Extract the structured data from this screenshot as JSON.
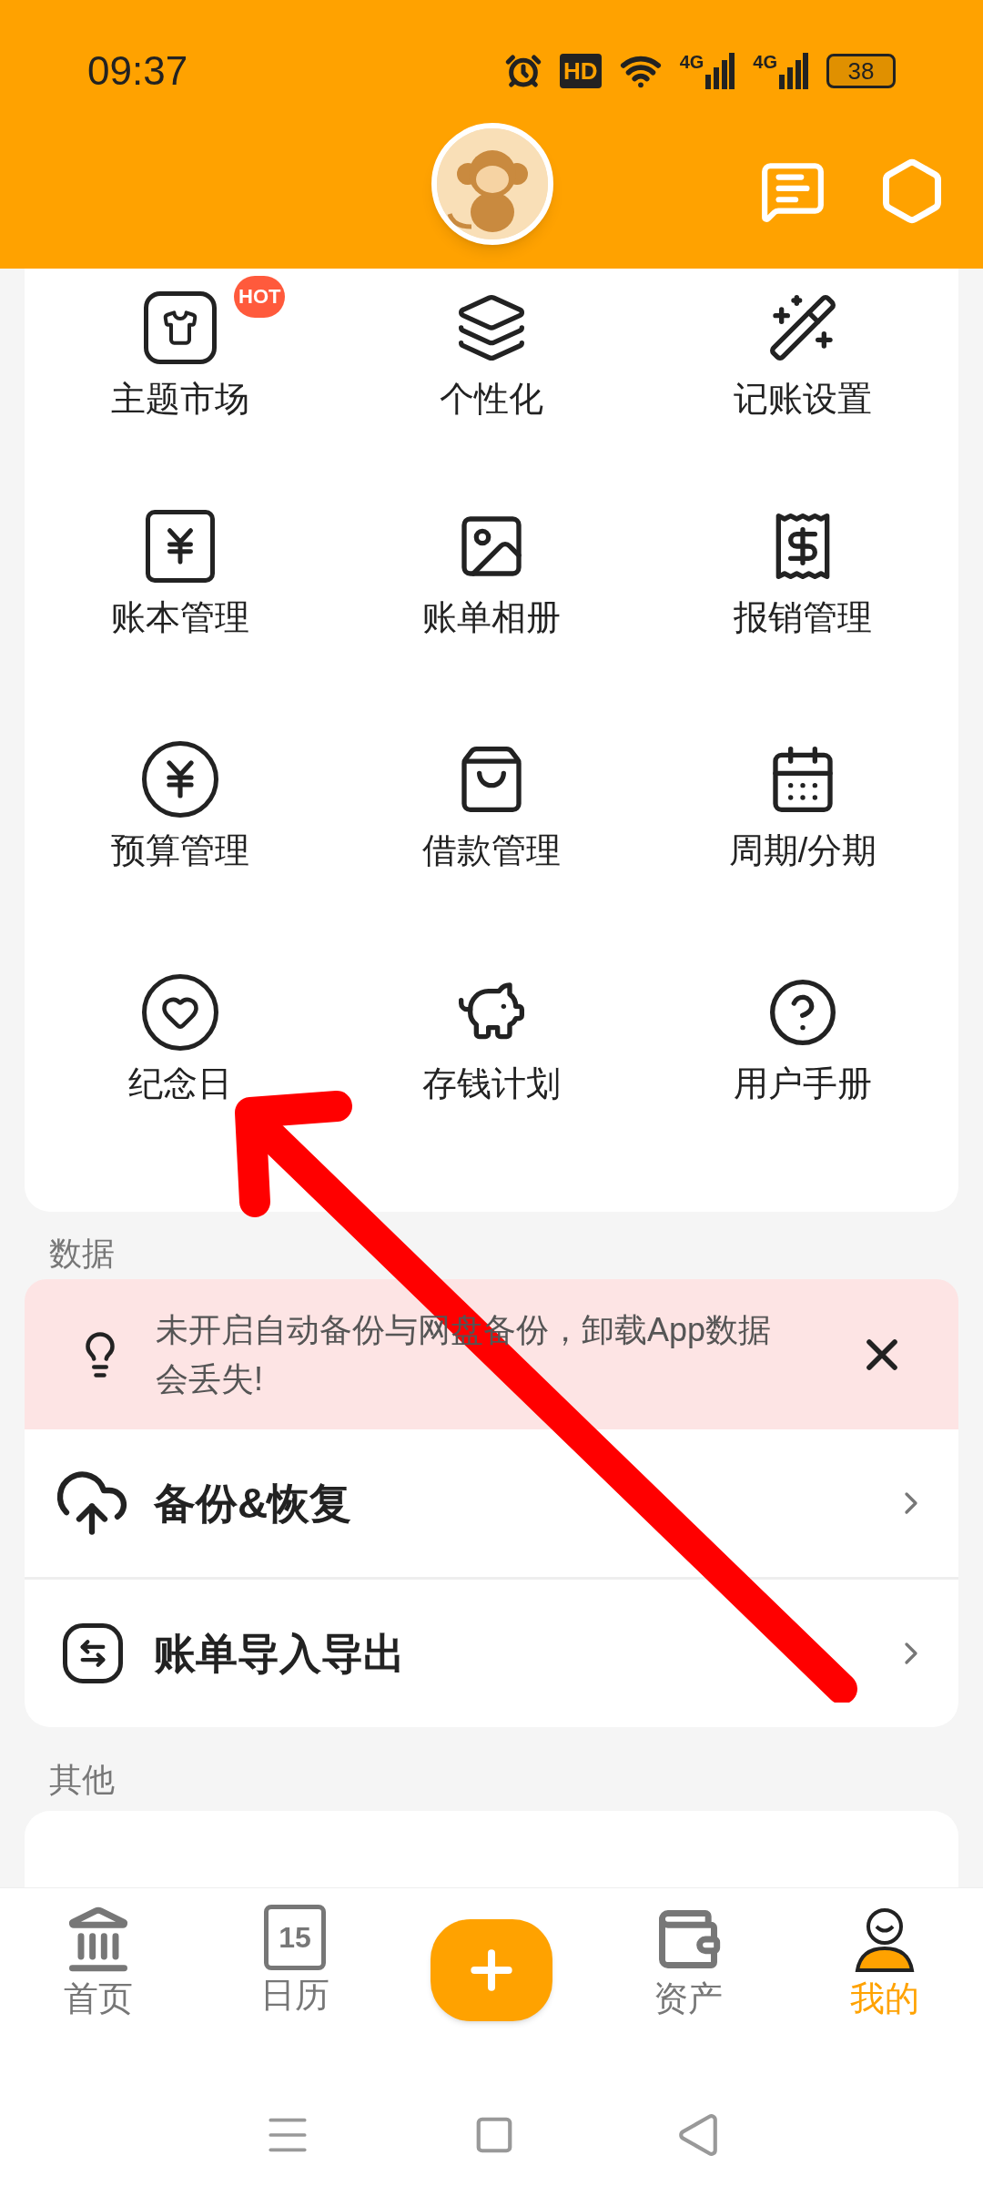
{
  "status_bar": {
    "time": "09:37",
    "hd": "HD",
    "network": [
      "4G",
      "4G"
    ],
    "battery": "38"
  },
  "features": [
    {
      "label": "主题市场",
      "badge": "HOT"
    },
    {
      "label": "个性化"
    },
    {
      "label": "记账设置"
    },
    {
      "label": "账本管理"
    },
    {
      "label": "账单相册"
    },
    {
      "label": "报销管理"
    },
    {
      "label": "预算管理"
    },
    {
      "label": "借款管理"
    },
    {
      "label": "周期/分期"
    },
    {
      "label": "纪念日"
    },
    {
      "label": "存钱计划"
    },
    {
      "label": "用户手册"
    }
  ],
  "data_section": {
    "title": "数据",
    "notice": "未开启自动备份与网盘备份，卸载App数据会丢失!",
    "rows": [
      {
        "label": "备份&恢复"
      },
      {
        "label": "账单导入导出"
      }
    ]
  },
  "other_section": {
    "title": "其他"
  },
  "bottom_nav": [
    {
      "label": "首页",
      "selected": false
    },
    {
      "label": "日历",
      "selected": false,
      "day": "15"
    },
    {
      "kind": "add"
    },
    {
      "label": "资产",
      "selected": false
    },
    {
      "label": "我的",
      "selected": true
    }
  ]
}
